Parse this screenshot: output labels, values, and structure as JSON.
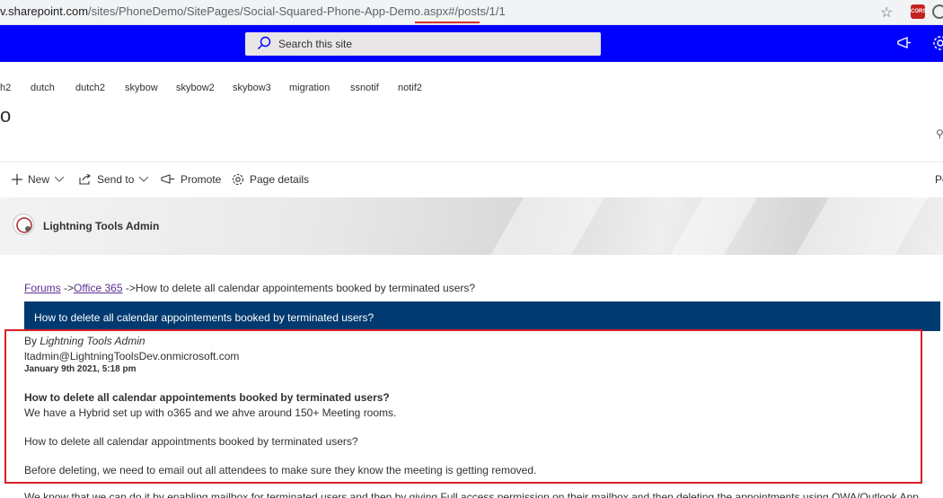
{
  "browser": {
    "url_prefix": "v.sharepoint.com",
    "url_path": "/sites/PhoneDemo/SitePages/Social-Squared-Phone-App-Demo.aspx#/posts/1/1",
    "cors_badge": "CORS"
  },
  "suite": {
    "search_placeholder": "Search this site",
    "bar_color": "#0000ff"
  },
  "site_nav": {
    "items": [
      "h2",
      "dutch",
      "dutch2",
      "skybow",
      "skybow2",
      "skybow3",
      "migration",
      "ssnotif",
      "notif2"
    ]
  },
  "site_title_fragment": "o",
  "command_bar": {
    "new_label": "New",
    "send_to_label": "Send to",
    "promote_label": "Promote",
    "page_details_label": "Page details",
    "edge_label": "Po"
  },
  "banner": {
    "author": "Lightning Tools Admin"
  },
  "breadcrumb": {
    "forums": "Forums",
    "sep1": " ->",
    "office365": "Office 365",
    "sep2": " ->",
    "current": "How to delete all calendar appointements booked by terminated users?"
  },
  "topic": {
    "title": "How to delete all calendar appointements booked by terminated users?",
    "header_color": "#003a70"
  },
  "post": {
    "by_label": "By ",
    "author": "Lightning Tools Admin",
    "email": "ltadmin@LightningToolsDev.onmicrosoft.com",
    "date": "January 9th 2021, 5:18 pm",
    "title": "How to delete all calendar appointements booked by terminated users?",
    "para1": "We have a Hybrid set up with o365 and we ahve around 150+ Meeting rooms.",
    "para2": "How to delete all calendar appointments booked by terminated users?",
    "para3": "Before deleting, we need to email out all attendees to make sure they know the meeting is getting removed.",
    "para4": "We know that we can do it by enabling mailbox for terminated users and then by giving Full access permission on their mailbox and then deleting the appointments using OWA/Outlook App"
  }
}
